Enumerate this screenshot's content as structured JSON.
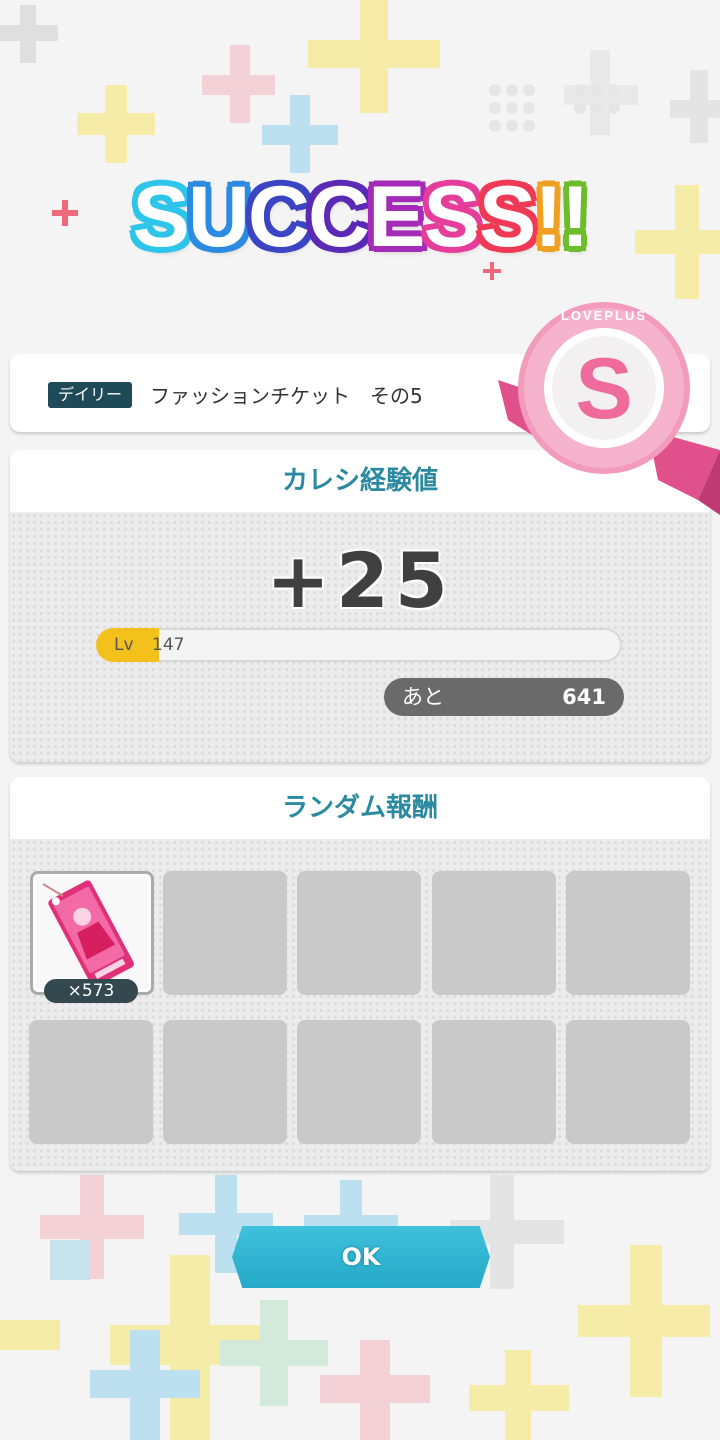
{
  "title": {
    "text": "SUCCESS!!",
    "letters": [
      {
        "ch": "S",
        "color": "#2ec5ea"
      },
      {
        "ch": "U",
        "color": "#2c8ae0"
      },
      {
        "ch": "C",
        "color": "#3b45c4"
      },
      {
        "ch": "C",
        "color": "#5a2ab4"
      },
      {
        "ch": "E",
        "color": "#a42ab8"
      },
      {
        "ch": "S",
        "color": "#e53e9a"
      },
      {
        "ch": "S",
        "color": "#f03a55"
      },
      {
        "ch": "!",
        "color": "#f0a020"
      },
      {
        "ch": "!",
        "color": "#6cbc2c"
      }
    ]
  },
  "mission": {
    "tag": "デイリー",
    "name": "ファッションチケット　その5"
  },
  "badge": {
    "letter": "S",
    "ring_text": "LOVEPLUS"
  },
  "experience": {
    "header": "カレシ経験値",
    "gain": "+25",
    "level_label": "Lv",
    "level": "147",
    "progress": 0.12,
    "remaining_label": "あと",
    "remaining": "641"
  },
  "rewards": {
    "header": "ランダム報酬",
    "items": [
      {
        "icon": "fashion-ticket-icon",
        "count": "×573"
      }
    ],
    "empty_slots": 9
  },
  "ok_button": {
    "label": "OK"
  },
  "colors": {
    "accent": "#2b8aa0",
    "ok_button": "#2fb4d2",
    "level_fill": "#f4c01c",
    "badge_pink": "#e8508c"
  }
}
